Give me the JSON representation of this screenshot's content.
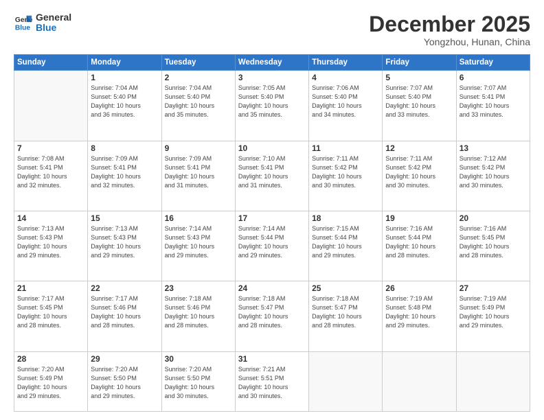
{
  "header": {
    "logo_line1": "General",
    "logo_line2": "Blue",
    "month": "December 2025",
    "location": "Yongzhou, Hunan, China"
  },
  "weekdays": [
    "Sunday",
    "Monday",
    "Tuesday",
    "Wednesday",
    "Thursday",
    "Friday",
    "Saturday"
  ],
  "weeks": [
    [
      {
        "day": "",
        "info": ""
      },
      {
        "day": "1",
        "info": "Sunrise: 7:04 AM\nSunset: 5:40 PM\nDaylight: 10 hours\nand 36 minutes."
      },
      {
        "day": "2",
        "info": "Sunrise: 7:04 AM\nSunset: 5:40 PM\nDaylight: 10 hours\nand 35 minutes."
      },
      {
        "day": "3",
        "info": "Sunrise: 7:05 AM\nSunset: 5:40 PM\nDaylight: 10 hours\nand 35 minutes."
      },
      {
        "day": "4",
        "info": "Sunrise: 7:06 AM\nSunset: 5:40 PM\nDaylight: 10 hours\nand 34 minutes."
      },
      {
        "day": "5",
        "info": "Sunrise: 7:07 AM\nSunset: 5:40 PM\nDaylight: 10 hours\nand 33 minutes."
      },
      {
        "day": "6",
        "info": "Sunrise: 7:07 AM\nSunset: 5:41 PM\nDaylight: 10 hours\nand 33 minutes."
      }
    ],
    [
      {
        "day": "7",
        "info": "Sunrise: 7:08 AM\nSunset: 5:41 PM\nDaylight: 10 hours\nand 32 minutes."
      },
      {
        "day": "8",
        "info": "Sunrise: 7:09 AM\nSunset: 5:41 PM\nDaylight: 10 hours\nand 32 minutes."
      },
      {
        "day": "9",
        "info": "Sunrise: 7:09 AM\nSunset: 5:41 PM\nDaylight: 10 hours\nand 31 minutes."
      },
      {
        "day": "10",
        "info": "Sunrise: 7:10 AM\nSunset: 5:41 PM\nDaylight: 10 hours\nand 31 minutes."
      },
      {
        "day": "11",
        "info": "Sunrise: 7:11 AM\nSunset: 5:42 PM\nDaylight: 10 hours\nand 30 minutes."
      },
      {
        "day": "12",
        "info": "Sunrise: 7:11 AM\nSunset: 5:42 PM\nDaylight: 10 hours\nand 30 minutes."
      },
      {
        "day": "13",
        "info": "Sunrise: 7:12 AM\nSunset: 5:42 PM\nDaylight: 10 hours\nand 30 minutes."
      }
    ],
    [
      {
        "day": "14",
        "info": "Sunrise: 7:13 AM\nSunset: 5:43 PM\nDaylight: 10 hours\nand 29 minutes."
      },
      {
        "day": "15",
        "info": "Sunrise: 7:13 AM\nSunset: 5:43 PM\nDaylight: 10 hours\nand 29 minutes."
      },
      {
        "day": "16",
        "info": "Sunrise: 7:14 AM\nSunset: 5:43 PM\nDaylight: 10 hours\nand 29 minutes."
      },
      {
        "day": "17",
        "info": "Sunrise: 7:14 AM\nSunset: 5:44 PM\nDaylight: 10 hours\nand 29 minutes."
      },
      {
        "day": "18",
        "info": "Sunrise: 7:15 AM\nSunset: 5:44 PM\nDaylight: 10 hours\nand 29 minutes."
      },
      {
        "day": "19",
        "info": "Sunrise: 7:16 AM\nSunset: 5:44 PM\nDaylight: 10 hours\nand 28 minutes."
      },
      {
        "day": "20",
        "info": "Sunrise: 7:16 AM\nSunset: 5:45 PM\nDaylight: 10 hours\nand 28 minutes."
      }
    ],
    [
      {
        "day": "21",
        "info": "Sunrise: 7:17 AM\nSunset: 5:45 PM\nDaylight: 10 hours\nand 28 minutes."
      },
      {
        "day": "22",
        "info": "Sunrise: 7:17 AM\nSunset: 5:46 PM\nDaylight: 10 hours\nand 28 minutes."
      },
      {
        "day": "23",
        "info": "Sunrise: 7:18 AM\nSunset: 5:46 PM\nDaylight: 10 hours\nand 28 minutes."
      },
      {
        "day": "24",
        "info": "Sunrise: 7:18 AM\nSunset: 5:47 PM\nDaylight: 10 hours\nand 28 minutes."
      },
      {
        "day": "25",
        "info": "Sunrise: 7:18 AM\nSunset: 5:47 PM\nDaylight: 10 hours\nand 28 minutes."
      },
      {
        "day": "26",
        "info": "Sunrise: 7:19 AM\nSunset: 5:48 PM\nDaylight: 10 hours\nand 29 minutes."
      },
      {
        "day": "27",
        "info": "Sunrise: 7:19 AM\nSunset: 5:49 PM\nDaylight: 10 hours\nand 29 minutes."
      }
    ],
    [
      {
        "day": "28",
        "info": "Sunrise: 7:20 AM\nSunset: 5:49 PM\nDaylight: 10 hours\nand 29 minutes."
      },
      {
        "day": "29",
        "info": "Sunrise: 7:20 AM\nSunset: 5:50 PM\nDaylight: 10 hours\nand 29 minutes."
      },
      {
        "day": "30",
        "info": "Sunrise: 7:20 AM\nSunset: 5:50 PM\nDaylight: 10 hours\nand 30 minutes."
      },
      {
        "day": "31",
        "info": "Sunrise: 7:21 AM\nSunset: 5:51 PM\nDaylight: 10 hours\nand 30 minutes."
      },
      {
        "day": "",
        "info": ""
      },
      {
        "day": "",
        "info": ""
      },
      {
        "day": "",
        "info": ""
      }
    ]
  ]
}
